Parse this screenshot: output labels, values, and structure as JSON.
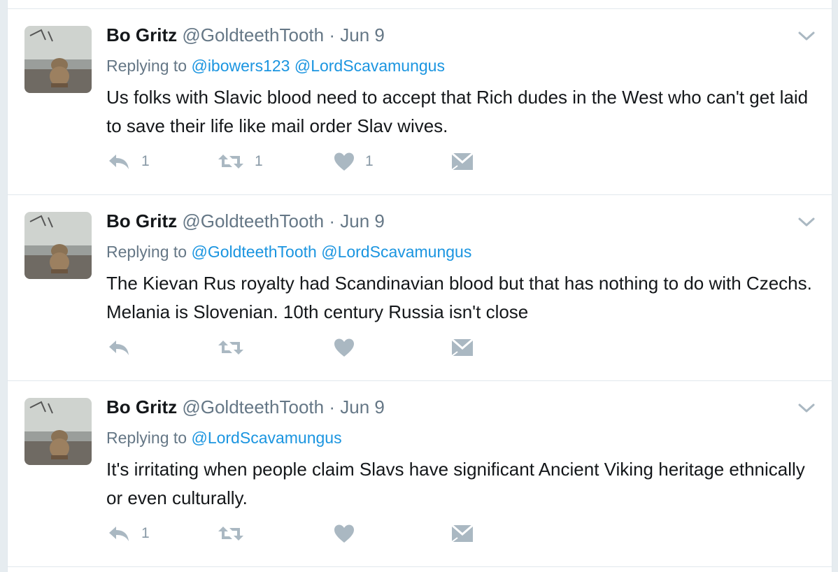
{
  "tweets": [
    {
      "name": "Bo Gritz",
      "handle": "@GoldteethTooth",
      "separator": "·",
      "time": "Jun 9",
      "replying_label": "Replying to",
      "mentions": [
        "@ibowers123",
        "@LordScavamungus"
      ],
      "text": "Us folks with Slavic blood need to accept that Rich dudes in the West who can't get laid to save their life like mail order Slav wives.",
      "reply_count": "1",
      "retweet_count": "1",
      "like_count": "1"
    },
    {
      "name": "Bo Gritz",
      "handle": "@GoldteethTooth",
      "separator": "·",
      "time": "Jun 9",
      "replying_label": "Replying to",
      "mentions": [
        "@GoldteethTooth",
        "@LordScavamungus"
      ],
      "text": "The Kievan Rus royalty had Scandinavian blood but that has nothing to do with Czechs. Melania is Slovenian. 10th century Russia isn't close",
      "reply_count": "",
      "retweet_count": "",
      "like_count": ""
    },
    {
      "name": "Bo Gritz",
      "handle": "@GoldteethTooth",
      "separator": "·",
      "time": "Jun 9",
      "replying_label": "Replying to",
      "mentions": [
        "@LordScavamungus"
      ],
      "text": "It's irritating when people claim Slavs have significant Ancient Viking heritage ethnically or even culturally.",
      "reply_count": "1",
      "retweet_count": "",
      "like_count": ""
    }
  ],
  "icons": {
    "reply": "reply-icon",
    "retweet": "retweet-icon",
    "like": "heart-icon",
    "message": "envelope-icon",
    "more": "chevron-down-icon"
  },
  "colors": {
    "background": "#e6ecf0",
    "card": "#ffffff",
    "text": "#14171a",
    "secondary": "#657786",
    "link": "#1b95e0",
    "icon": "#aab8c2",
    "border": "#e1e8ed"
  }
}
